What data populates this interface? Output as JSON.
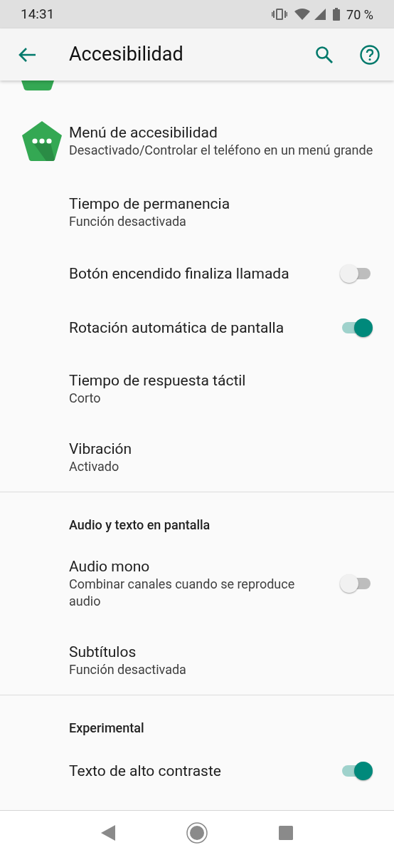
{
  "status_bar": {
    "time": "14:31",
    "battery": "70 %"
  },
  "app_bar": {
    "title": "Accesibilidad"
  },
  "sections": [
    {
      "items": [
        {
          "kind": "icon",
          "title": "Menú de accesibilidad",
          "subtitle": "Desactivado/Controlar el teléfono en un menú grande"
        },
        {
          "kind": "text",
          "title": "Tiempo de permanencia",
          "subtitle": "Función desactivada"
        },
        {
          "kind": "switch",
          "title": "Botón encendido finaliza llamada",
          "on": false
        },
        {
          "kind": "switch",
          "title": "Rotación automática de pantalla",
          "on": true
        },
        {
          "kind": "text",
          "title": "Tiempo de respuesta táctil",
          "subtitle": "Corto"
        },
        {
          "kind": "text",
          "title": "Vibración",
          "subtitle": "Activado"
        }
      ]
    },
    {
      "header": "Audio y texto en pantalla",
      "items": [
        {
          "kind": "switch",
          "title": "Audio mono",
          "subtitle": "Combinar canales cuando se reproduce audio",
          "on": false
        },
        {
          "kind": "text",
          "title": "Subtítulos",
          "subtitle": "Función desactivada"
        }
      ]
    },
    {
      "header": "Experimental",
      "items": [
        {
          "kind": "switch",
          "title": "Texto de alto contraste",
          "on": true
        }
      ]
    }
  ]
}
